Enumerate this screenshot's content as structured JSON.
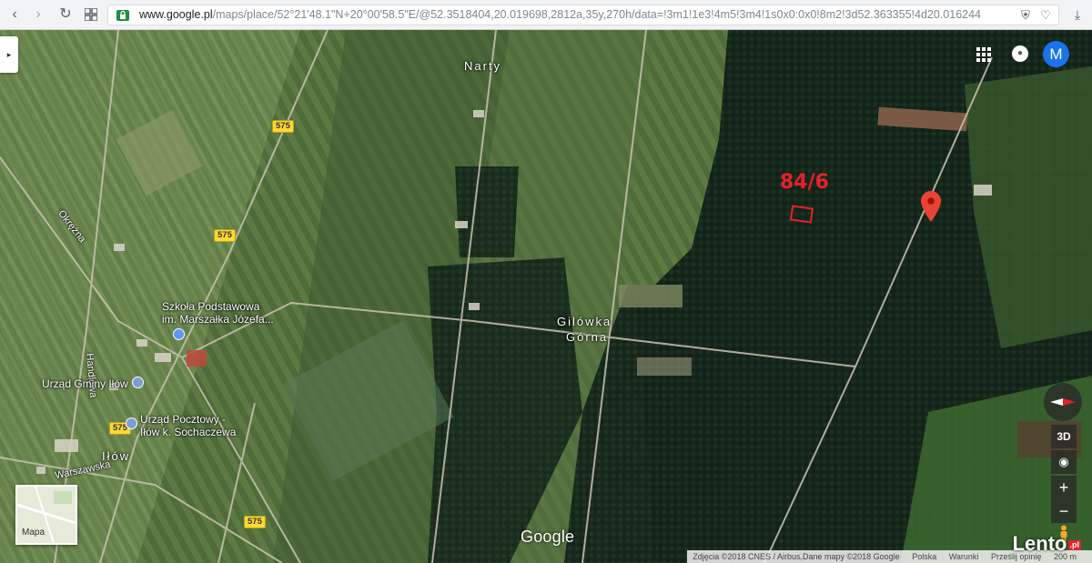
{
  "browser": {
    "url_host": "www.google.pl",
    "url_rest": "/maps/place/52°21'48.1\"N+20°00'58.5\"E/@52.3518404,20.019698,2812a,35y,270h/data=!3m1!1e3!4m5!3m4!1s0x0:0x0!8m2!3d52.363355!4d20.016244",
    "back_icon": "back-arrow-icon",
    "forward_icon": "forward-arrow-icon",
    "reload_icon": "reload-icon",
    "apps_icon": "apps-grid-icon"
  },
  "map": {
    "places": [
      {
        "name": "Narty"
      },
      {
        "name": "Gilówka"
      },
      {
        "name": "Górna"
      },
      {
        "name": "Iłów"
      }
    ],
    "pois": [
      {
        "name_line1": "Szkoła Podstawowa",
        "name_line2": "im. Marszałka Józefa..."
      },
      {
        "name_line1": "Urząd Gminy Iłów"
      },
      {
        "name_line1": "Urząd Pocztowy -",
        "name_line2": "Iłów k. Sochaczewa"
      }
    ],
    "roads": {
      "okrezna": "Okrężna",
      "handlowa": "Handlowa",
      "warszawska": "Warszawska",
      "route_number": "575"
    },
    "parcel_label": "84/6",
    "colors": {
      "parcel": "#e8202a",
      "accent_avatar": "#1a73e8",
      "route_shield": "#fdd835"
    }
  },
  "controls": {
    "avatar_letter": "M",
    "btn_3d": "3D",
    "zoom_in": "+",
    "zoom_out": "−",
    "minimap_label": "Mapa",
    "side_toggle": "▸"
  },
  "branding": {
    "google": "Google",
    "lento": "Lento",
    "lento_suffix": ".pl"
  },
  "attribution": {
    "imagery": "Zdjęcia ©2018 CNES / Airbus,Dane mapy ©2018 Google",
    "country": "Polska",
    "terms": "Warunki",
    "feedback": "Prześlij opinię",
    "scale": "200 m"
  }
}
